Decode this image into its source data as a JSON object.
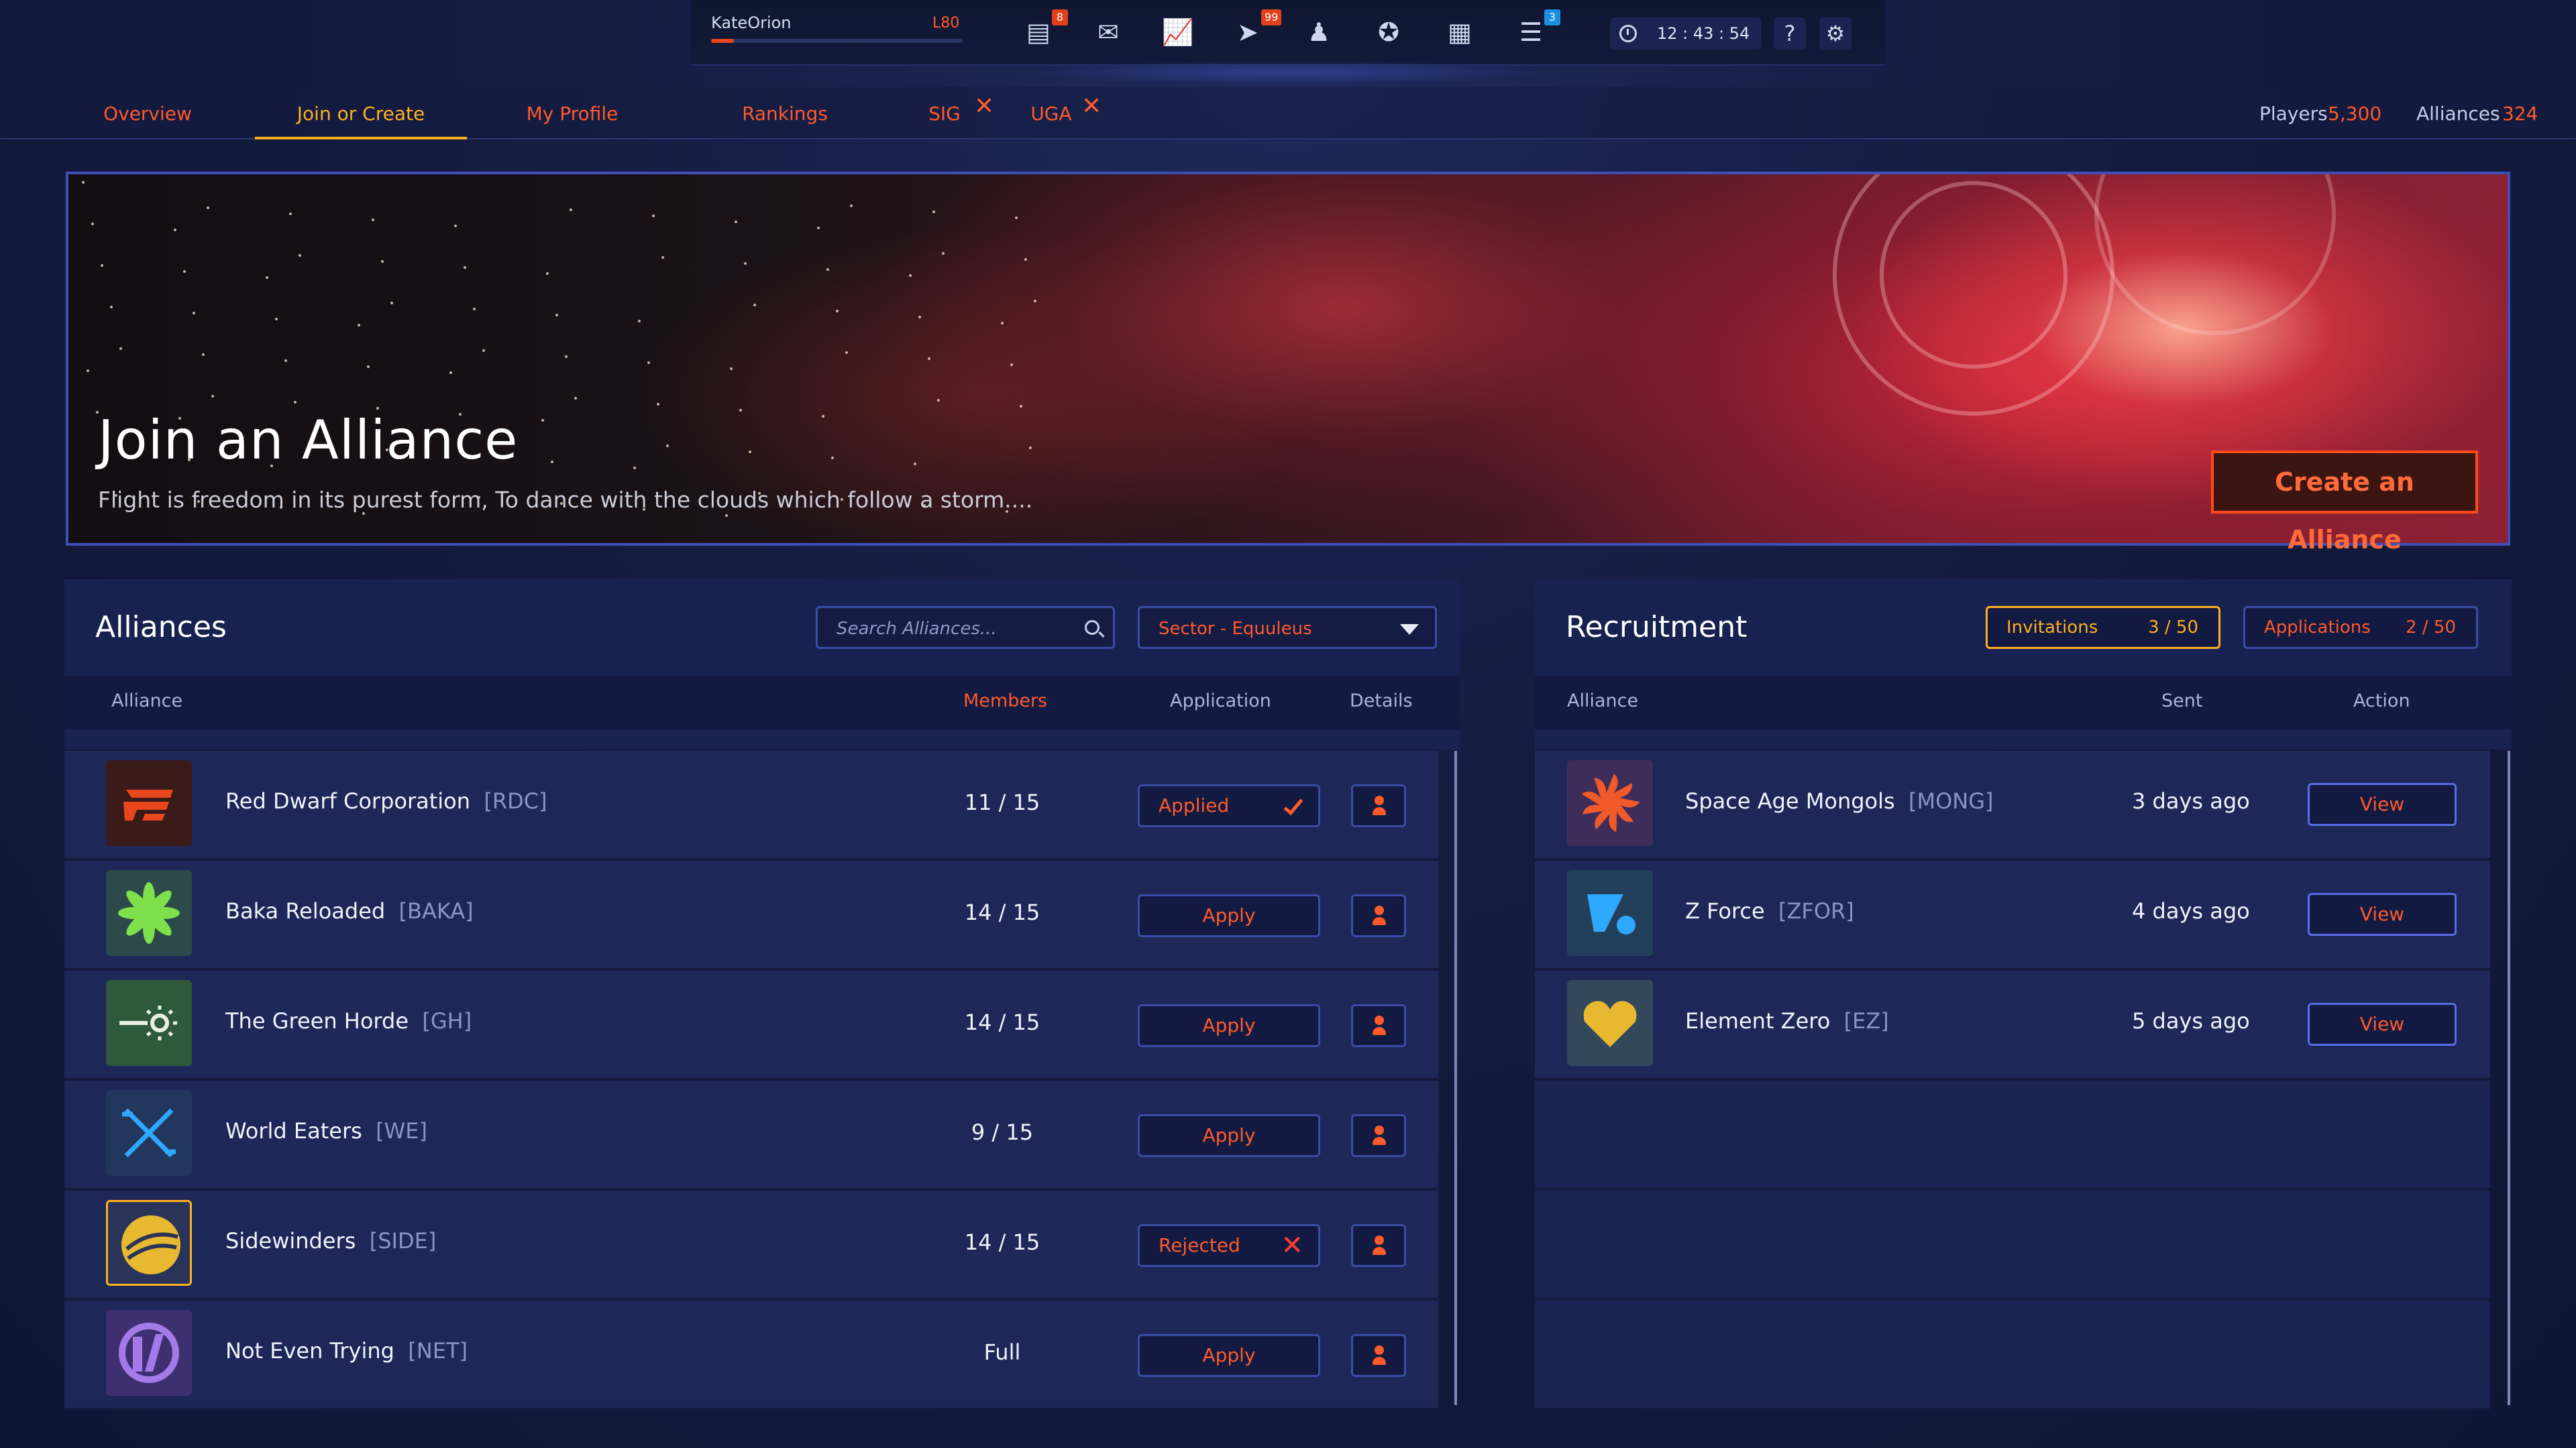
{
  "hud": {
    "player_name": "KateOrion",
    "level": "L80",
    "xp_fraction": 0.09,
    "icons": [
      {
        "name": "reports-icon",
        "glyph": "▤",
        "badge": "8",
        "badge_color": "#e2401a"
      },
      {
        "name": "mail-icon",
        "glyph": "✉",
        "badge": null
      },
      {
        "name": "stats-icon",
        "glyph": "📈",
        "badge": null
      },
      {
        "name": "fleet-icon",
        "glyph": "➤",
        "badge": "99",
        "badge_color": "#e2401a"
      },
      {
        "name": "alliance-icon",
        "glyph": "♟",
        "badge": null
      },
      {
        "name": "badge-icon",
        "glyph": "✪",
        "badge": null
      },
      {
        "name": "grid-icon",
        "glyph": "▦",
        "badge": null
      },
      {
        "name": "resources-icon",
        "glyph": "☰",
        "badge": "3",
        "badge_color": "#1a8fe0"
      }
    ],
    "clock": "12 : 43 : 54",
    "help_glyph": "?",
    "settings_glyph": "⚙"
  },
  "nav": {
    "tabs": [
      "Overview",
      "Join or Create",
      "My Profile",
      "Rankings",
      "SIG",
      "UGA"
    ],
    "active_tab": "Join or Create",
    "close_glyph": "✕",
    "players_label": "Players",
    "players_value": "5,300",
    "alliances_label": "Alliances",
    "alliances_value": "324"
  },
  "hero": {
    "title": "Join an Alliance",
    "subtitle": "Flight is freedom in its purest form, To dance with the clouds which follow a storm....",
    "create_button": "Create an Alliance"
  },
  "alliances": {
    "title": "Alliances",
    "search_placeholder": "Search Alliances...",
    "sector": "Sector - Equuleus",
    "headers": {
      "alliance": "Alliance",
      "members": "Members",
      "application": "Application",
      "details": "Details"
    },
    "rows": [
      {
        "name": "Red Dwarf Corporation",
        "tag": "[RDC]",
        "members": "11 / 15",
        "status": "Applied",
        "state": "applied",
        "logo_bg": "#3b1a1a",
        "logo_fg": "#e8461c",
        "logo": "rdc"
      },
      {
        "name": "Baka Reloaded",
        "tag": "[BAKA]",
        "members": "14 / 15",
        "status": "Apply",
        "state": "apply",
        "logo_bg": "#2d4a4a",
        "logo_fg": "#7ee04a",
        "logo": "star"
      },
      {
        "name": "The Green Horde",
        "tag": "[GH]",
        "members": "14 / 15",
        "status": "Apply",
        "state": "apply",
        "logo_bg": "#2e5a3a",
        "logo_fg": "#e8f0e0",
        "logo": "sun"
      },
      {
        "name": "World Eaters",
        "tag": "[WE]",
        "members": "9 / 15",
        "status": "Apply",
        "state": "apply",
        "logo_bg": "#23365e",
        "logo_fg": "#2ea8ff",
        "logo": "x"
      },
      {
        "name": "Sidewinders",
        "tag": "[SIDE]",
        "members": "14 / 15",
        "status": "Rejected",
        "state": "rejected",
        "logo_bg": "#2a3458",
        "logo_fg": "#e8b830",
        "logo": "planet"
      },
      {
        "name": "Not Even Trying",
        "tag": "[NET]",
        "members": "Full",
        "status": "Apply",
        "state": "apply",
        "logo_bg": "#3e3070",
        "logo_fg": "#a47ae8",
        "logo": "net"
      }
    ]
  },
  "recruitment": {
    "title": "Recruitment",
    "invitations_label": "Invitations",
    "invitations_count": "3 / 50",
    "applications_label": "Applications",
    "applications_count": "2 / 50",
    "headers": {
      "alliance": "Alliance",
      "sent": "Sent",
      "action": "Action"
    },
    "rows": [
      {
        "name": "Space Age Mongols",
        "tag": "[MONG]",
        "sent": "3 days ago",
        "action": "View",
        "logo_bg": "#3e2d5a",
        "logo_fg": "#f05a2a",
        "logo": "swirl"
      },
      {
        "name": "Z Force",
        "tag": "[ZFOR]",
        "sent": "4 days ago",
        "action": "View",
        "logo_bg": "#22405a",
        "logo_fg": "#2ea8ff",
        "logo": "pct"
      },
      {
        "name": "Element Zero",
        "tag": "[EZ]",
        "sent": "5 days ago",
        "action": "View",
        "logo_bg": "#33485a",
        "logo_fg": "#e8b830",
        "logo": "heart"
      }
    ]
  }
}
